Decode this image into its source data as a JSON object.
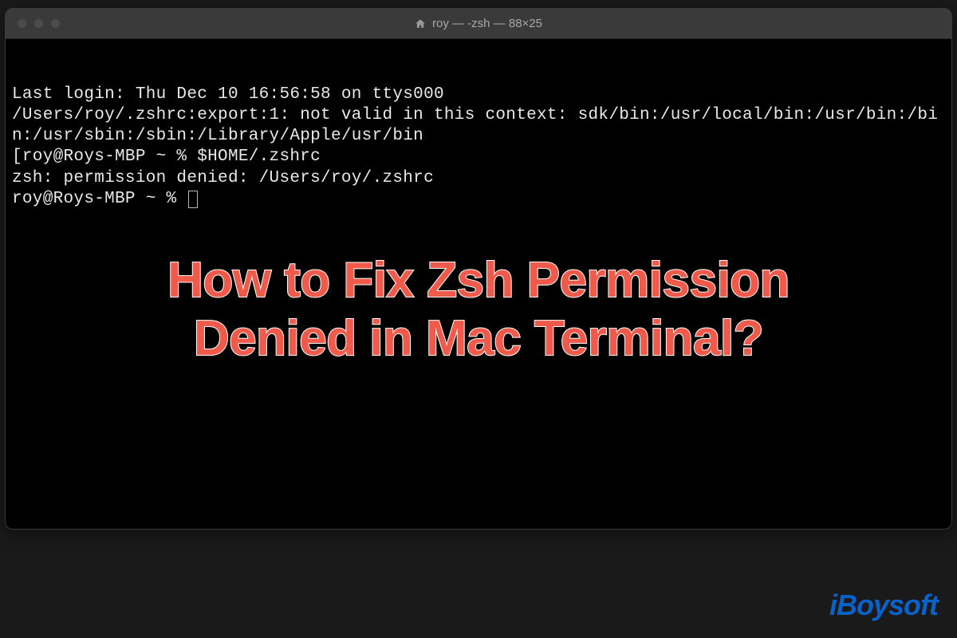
{
  "titlebar": {
    "title": "roy — -zsh — 88×25"
  },
  "terminal": {
    "lines": [
      "Last login: Thu Dec 10 16:56:58 on ttys000",
      "/Users/roy/.zshrc:export:1: not valid in this context: sdk/bin:/usr/local/bin:/usr/bin:/bin:/usr/sbin:/sbin:/Library/Apple/usr/bin",
      "[roy@Roys-MBP ~ % $HOME/.zshrc",
      "zsh: permission denied: /Users/roy/.zshrc",
      "roy@Roys-MBP ~ % "
    ]
  },
  "overlay": {
    "heading_line1": "How to Fix Zsh Permission",
    "heading_line2": "Denied in Mac Terminal?"
  },
  "watermark": {
    "text": "iBoysoft"
  }
}
